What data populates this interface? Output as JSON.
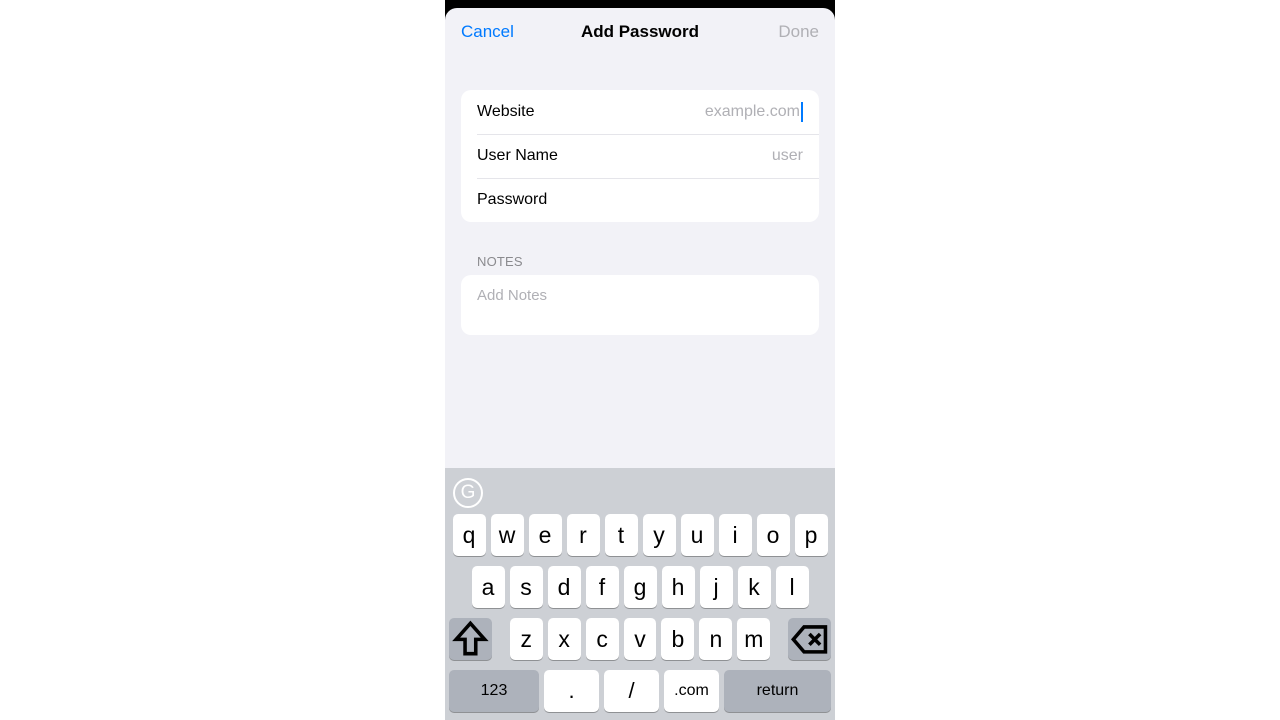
{
  "nav": {
    "cancel": "Cancel",
    "title": "Add Password",
    "done": "Done"
  },
  "form": {
    "website": {
      "label": "Website",
      "placeholder": "example.com",
      "value": ""
    },
    "username": {
      "label": "User Name",
      "placeholder": "user",
      "value": ""
    },
    "password": {
      "label": "Password",
      "placeholder": "",
      "value": ""
    }
  },
  "notes": {
    "header": "NOTES",
    "placeholder": "Add Notes"
  },
  "keyboard": {
    "badge_letter": "G",
    "row1": [
      "q",
      "w",
      "e",
      "r",
      "t",
      "y",
      "u",
      "i",
      "o",
      "p"
    ],
    "row2": [
      "a",
      "s",
      "d",
      "f",
      "g",
      "h",
      "j",
      "k",
      "l"
    ],
    "row3": [
      "z",
      "x",
      "c",
      "v",
      "b",
      "n",
      "m"
    ],
    "numkey": "123",
    "dot": ".",
    "slash": "/",
    "com": ".com",
    "return": "return"
  }
}
